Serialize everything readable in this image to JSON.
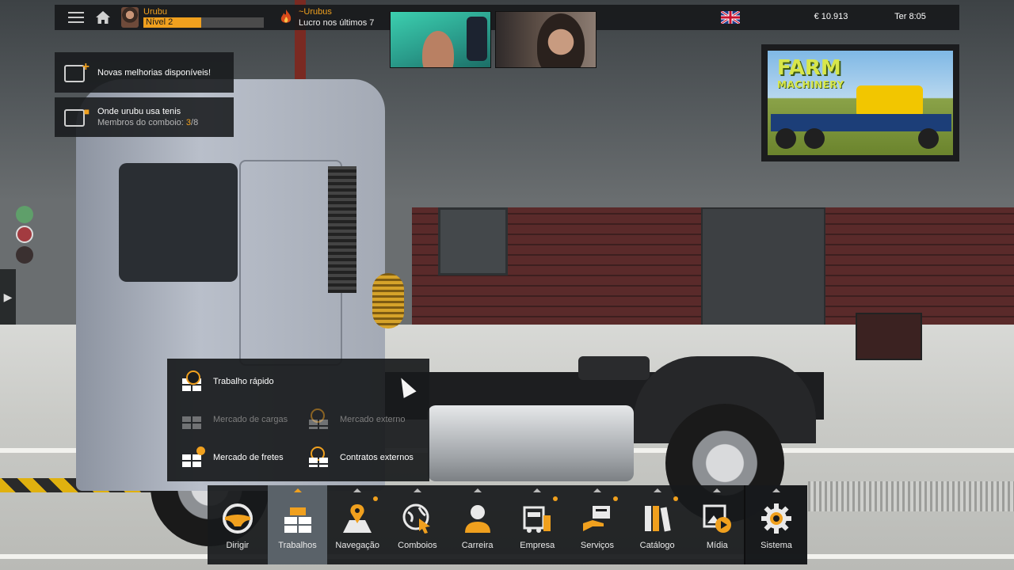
{
  "topbar": {
    "profile": {
      "name": "Urubu",
      "level": "Nível 2",
      "level_progress": 0.48
    },
    "convoy": {
      "name": "~Urubus",
      "subtitle": "Lucro nos últimos 7"
    },
    "language_flag": "uk-flag-icon",
    "money": "€ 10.913",
    "time": "Ter 8:05"
  },
  "notifications": [
    {
      "title": "Novas melhorias disponíveis!",
      "icon": "truck-upgrade-icon"
    },
    {
      "title": "Onde urubu usa tenis",
      "members_label": "Membros do comboio:",
      "members_current": "3",
      "members_total": "/8",
      "icon": "convoy-truck-icon"
    }
  ],
  "ad": {
    "title": "FARM",
    "subtitle": "MACHINERY"
  },
  "jobs_menu": {
    "items": [
      {
        "label": "Trabalho rápido",
        "enabled": true
      },
      {
        "label": "Mercado de cargas",
        "enabled": false
      },
      {
        "label": "Mercado externo",
        "enabled": false
      },
      {
        "label": "Mercado de fretes",
        "enabled": true
      },
      {
        "label": "Contratos externos",
        "enabled": true
      }
    ]
  },
  "bottom_menu": {
    "items": [
      {
        "label": "Dirigir",
        "icon": "steering-wheel-icon"
      },
      {
        "label": "Trabalhos",
        "icon": "cargo-crates-icon",
        "active": true
      },
      {
        "label": "Navegação",
        "icon": "map-pin-icon",
        "notify": true
      },
      {
        "label": "Comboios",
        "icon": "globe-cursor-icon"
      },
      {
        "label": "Carreira",
        "icon": "person-icon"
      },
      {
        "label": "Empresa",
        "icon": "company-truck-icon",
        "notify": true
      },
      {
        "label": "Serviços",
        "icon": "service-hand-icon",
        "notify": true
      },
      {
        "label": "Catálogo",
        "icon": "books-icon",
        "notify": true
      },
      {
        "label": "Mídia",
        "icon": "media-icon"
      },
      {
        "label": "Sistema",
        "icon": "gear-icon"
      }
    ]
  },
  "colors": {
    "accent": "#f0a01e",
    "panel": "#18191b",
    "active_tab": "#5a6269"
  }
}
